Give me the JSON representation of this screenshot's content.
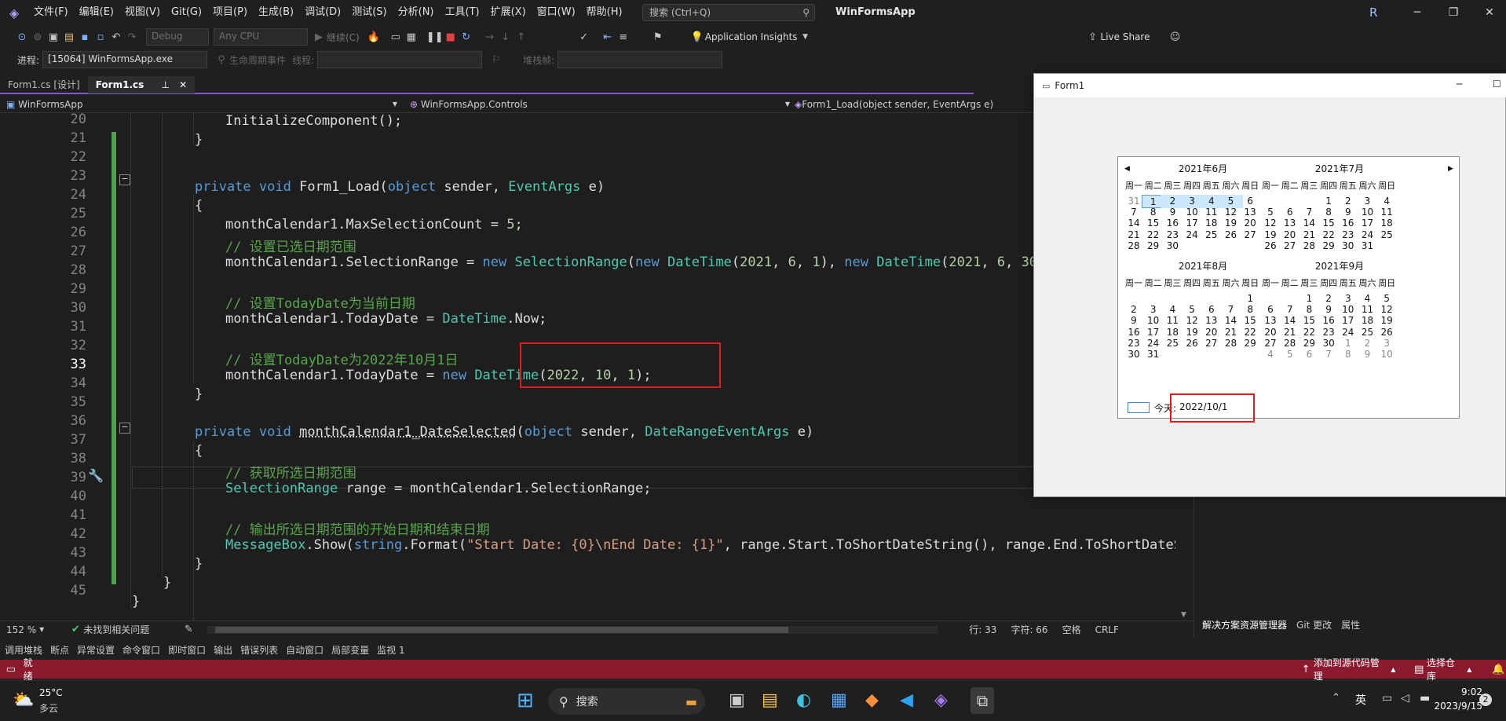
{
  "menubar": {
    "items": [
      "文件(F)",
      "编辑(E)",
      "视图(V)",
      "Git(G)",
      "项目(P)",
      "生成(B)",
      "调试(D)",
      "测试(S)",
      "分析(N)",
      "工具(T)",
      "扩展(X)",
      "窗口(W)",
      "帮助(H)"
    ],
    "search_placeholder": "搜索 (Ctrl+Q)",
    "app_title": "WinFormsApp",
    "user_initial": "R"
  },
  "toolbar": {
    "config": "Debug",
    "platform": "Any CPU",
    "continue_label": "继续(C)",
    "app_insights": "Application Insights",
    "live_share": "Live Share"
  },
  "toolbar2": {
    "process_label": "进程:",
    "process_value": "[15064] WinFormsApp.exe",
    "lifecycle_label": "生命周期事件",
    "thread_label": "线程:",
    "stackframe_label": "堆栈帧:"
  },
  "tabs": [
    {
      "label": "Form1.cs [设计]",
      "active": false
    },
    {
      "label": "Form1.cs",
      "active": true
    }
  ],
  "navbar": {
    "project": "WinFormsApp",
    "namespace": "WinFormsApp.Controls",
    "member": "Form1_Load(object sender, EventArgs e)"
  },
  "editor": {
    "line_numbers": [
      "20",
      "21",
      "22",
      "23",
      "24",
      "25",
      "26",
      "27",
      "28",
      "29",
      "30",
      "31",
      "32",
      "33",
      "34",
      "35",
      "36",
      "37",
      "38",
      "39",
      "40",
      "41",
      "42",
      "43",
      "44",
      "45"
    ],
    "current_line": "33"
  },
  "editor_status": {
    "zoom": "152 %",
    "issues": "未找到相关问题",
    "line": "行: 33",
    "char": "字符: 66",
    "space": "空格",
    "eol": "CRLF"
  },
  "right_panel_tabs": [
    "解决方案资源管理器",
    "Git 更改",
    "属性"
  ],
  "tool_tabs": [
    "调用堆栈",
    "断点",
    "异常设置",
    "命令窗口",
    "即时窗口",
    "输出",
    "错误列表",
    "自动窗口",
    "局部变量",
    "监视 1"
  ],
  "statusbar": {
    "ready": "就绪",
    "add_source": "添加到源代码管理",
    "select_repo": "选择仓库"
  },
  "taskbar": {
    "weather_temp": "25°C",
    "weather_desc": "多云",
    "search_label": "搜索",
    "ime": "英",
    "time": "9:02",
    "date": "2023/9/15",
    "notif_count": "2"
  },
  "form1": {
    "title": "Form1",
    "months": [
      {
        "title": "2021年6月"
      },
      {
        "title": "2021年7月"
      },
      {
        "title": "2021年8月"
      },
      {
        "title": "2021年9月"
      }
    ],
    "dow": [
      "周一",
      "周二",
      "周三",
      "周四",
      "周五",
      "周六",
      "周日"
    ],
    "today_label": "今天:",
    "today_value": "2022/10/1"
  },
  "colors": {
    "accent": "#7a5bd8",
    "status_bar": "#8b1a2e",
    "annotation_red": "#e01b1b",
    "selection": "#cce8ff"
  }
}
